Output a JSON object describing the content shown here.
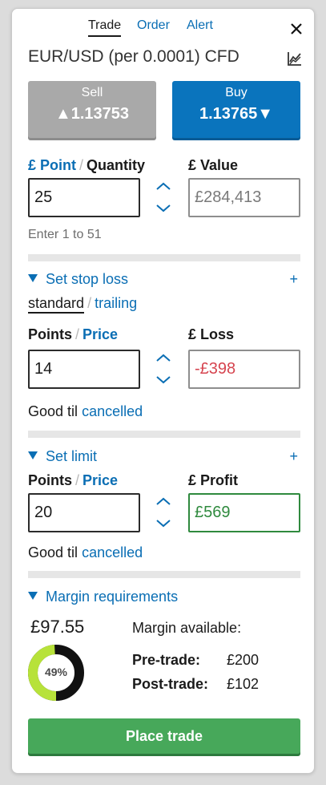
{
  "tabs": [
    {
      "label": "Trade"
    },
    {
      "label": "Order"
    },
    {
      "label": "Alert"
    }
  ],
  "instrument": {
    "title": "EUR/USD (per 0.0001) CFD"
  },
  "sell": {
    "label": "Sell",
    "price": "▲1.13753"
  },
  "buy": {
    "label": "Buy",
    "price": "1.13765▼"
  },
  "size": {
    "point_label": "£ Point",
    "quantity_label": "Quantity",
    "value_label": "£ Value",
    "quantity_value": "25",
    "value_placeholder": "£284,413",
    "hint": "Enter 1 to 51"
  },
  "stop": {
    "toggle_label": "Set stop loss",
    "plus": "+",
    "mode_standard": "standard",
    "mode_trailing": "trailing",
    "points_label": "Points",
    "price_label": "Price",
    "loss_label": "£ Loss",
    "points_value": "14",
    "loss_value": "-£398",
    "good_til_prefix": "Good til",
    "good_til_link": "cancelled"
  },
  "limit": {
    "toggle_label": "Set limit",
    "plus": "+",
    "points_label": "Points",
    "price_label": "Price",
    "profit_label": "£ Profit",
    "points_value": "20",
    "profit_value": "£569",
    "good_til_prefix": "Good til",
    "good_til_link": "cancelled"
  },
  "margin": {
    "toggle_label": "Margin requirements",
    "amount": "£97.55",
    "percent": 49,
    "percent_label": "49%",
    "available_label": "Margin available:",
    "pre_label": "Pre-trade:",
    "pre_value": "£200",
    "post_label": "Post-trade:",
    "post_value": "£102"
  },
  "place_trade": {
    "label": "Place trade"
  },
  "colors": {
    "accent": "#0a6eb4",
    "sell": "#a9a9a9",
    "buy": "#0a74bd",
    "place_trade": "#47a85a",
    "loss": "#d64550",
    "profit": "#2f8a3e",
    "donut_fill": "#b7e23a",
    "donut_track": "#111111"
  },
  "icons": {
    "close": "close-icon",
    "chart": "chart-line-icon",
    "up": "chevron-up-icon",
    "down": "chevron-down-icon"
  }
}
